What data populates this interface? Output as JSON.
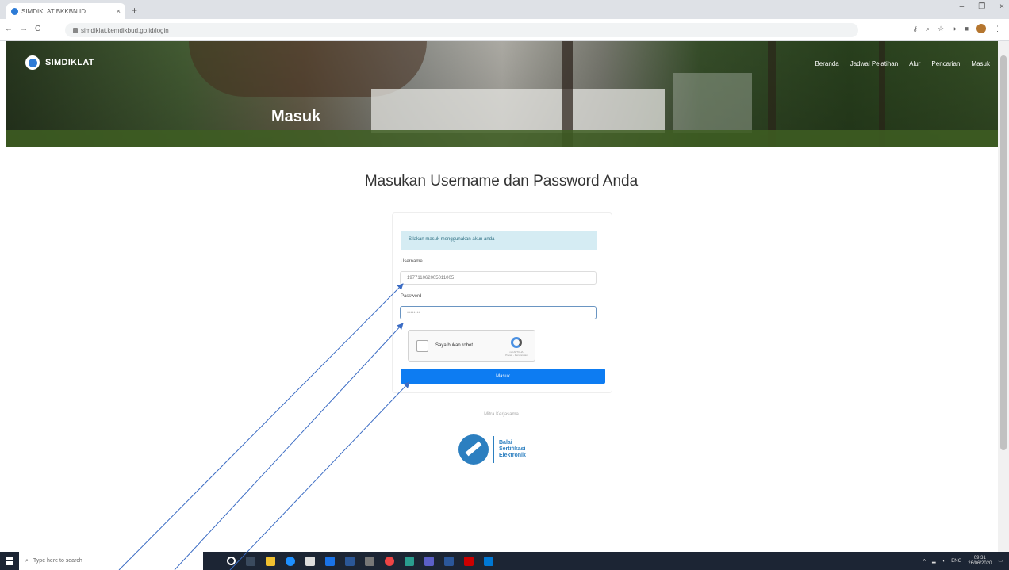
{
  "browser": {
    "tab_title": "SIMDIKLAT BKKBN ID",
    "tab_close": "×",
    "new_tab": "+",
    "window_controls": [
      "–",
      "❐",
      "×"
    ],
    "nav_buttons": [
      "←",
      "→",
      "C"
    ],
    "address": "simdiklat.kemdikbud.go.id/login",
    "lock_icon": "lock-icon"
  },
  "site": {
    "logo_text": "SIMDIKLAT",
    "nav": [
      "Beranda",
      "Jadwal Pelatihan",
      "Alur",
      "Pencarian",
      "Masuk"
    ],
    "hero_title": "Masuk"
  },
  "login": {
    "heading": "Masukan Username dan Password Anda",
    "alert": "Silakan masuk menggunakan akun anda",
    "username_label": "Username",
    "username_value": "197711062005011005",
    "password_label": "Password",
    "password_value": "••••••••",
    "captcha_label": "Saya bukan robot",
    "captcha_brand": "reCAPTCHA",
    "captcha_terms": "Privasi - Persyaratan",
    "submit": "Masuk"
  },
  "partner": {
    "label": "Mitra Kerjasama",
    "bse_lines": [
      "Balai",
      "Sertifikasi",
      "Elektronik"
    ]
  },
  "taskbar": {
    "search_placeholder": "Type here to search",
    "time": "09:31",
    "date": "26/06/2020",
    "lang": "ENG"
  }
}
